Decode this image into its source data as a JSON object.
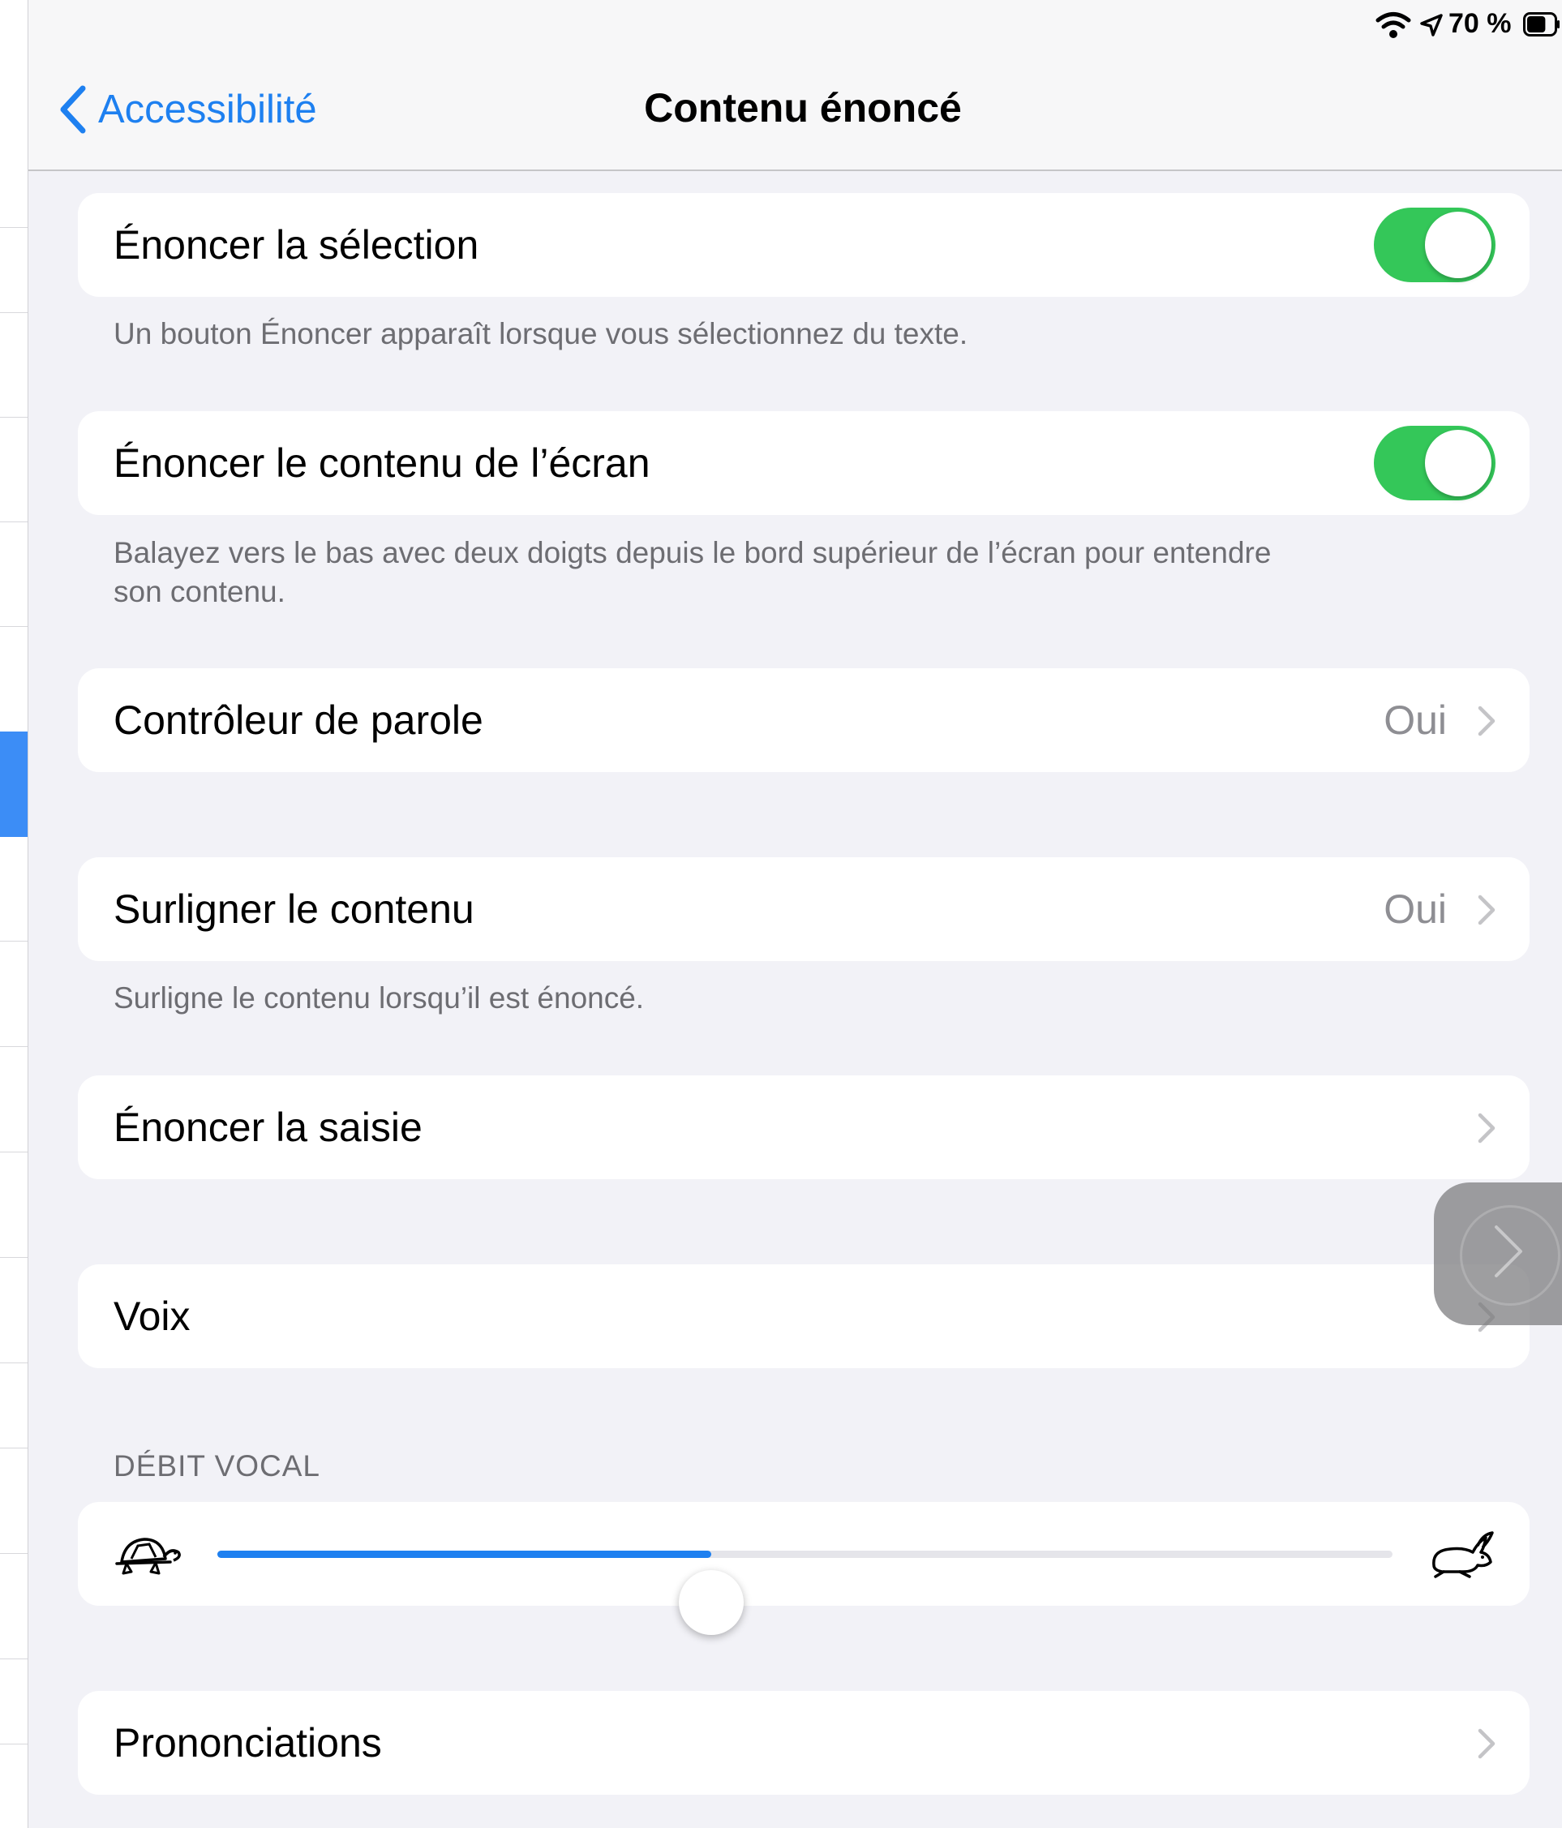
{
  "status_bar": {
    "battery_percent": "70 %",
    "battery_level": 0.7,
    "icons": [
      "wifi-icon",
      "location-icon",
      "battery-icon"
    ]
  },
  "nav": {
    "back_label": "Accessibilité",
    "title": "Contenu énoncé"
  },
  "colors": {
    "accent": "#1e80f0",
    "toggle_on": "#34c759",
    "background": "#f2f2f7"
  },
  "rows": {
    "speak_selection": {
      "label": "Énoncer la sélection",
      "on": true
    },
    "speak_selection_footer": "Un bouton Énoncer apparaît lorsque vous sélectionnez du texte.",
    "speak_screen": {
      "label": "Énoncer le contenu de l’écran",
      "on": true
    },
    "speak_screen_footer_line1": "Balayez vers le bas avec deux doigts depuis le bord supérieur de l’écran pour entendre",
    "speak_screen_footer_line2": "son contenu.",
    "speech_controller": {
      "label": "Contrôleur de parole",
      "value": "Oui"
    },
    "highlight_content": {
      "label": "Surligner le contenu",
      "value": "Oui"
    },
    "highlight_footer": "Surligne le contenu lorsqu’il est énoncé.",
    "typing_feedback": {
      "label": "Énoncer la saisie"
    },
    "voices": {
      "label": "Voix"
    },
    "speaking_rate_header": "DÉBIT VOCAL",
    "speaking_rate": {
      "value": 0.42,
      "min_icon": "turtle-icon",
      "max_icon": "rabbit-icon"
    },
    "pronunciations": {
      "label": "Prononciations"
    }
  }
}
